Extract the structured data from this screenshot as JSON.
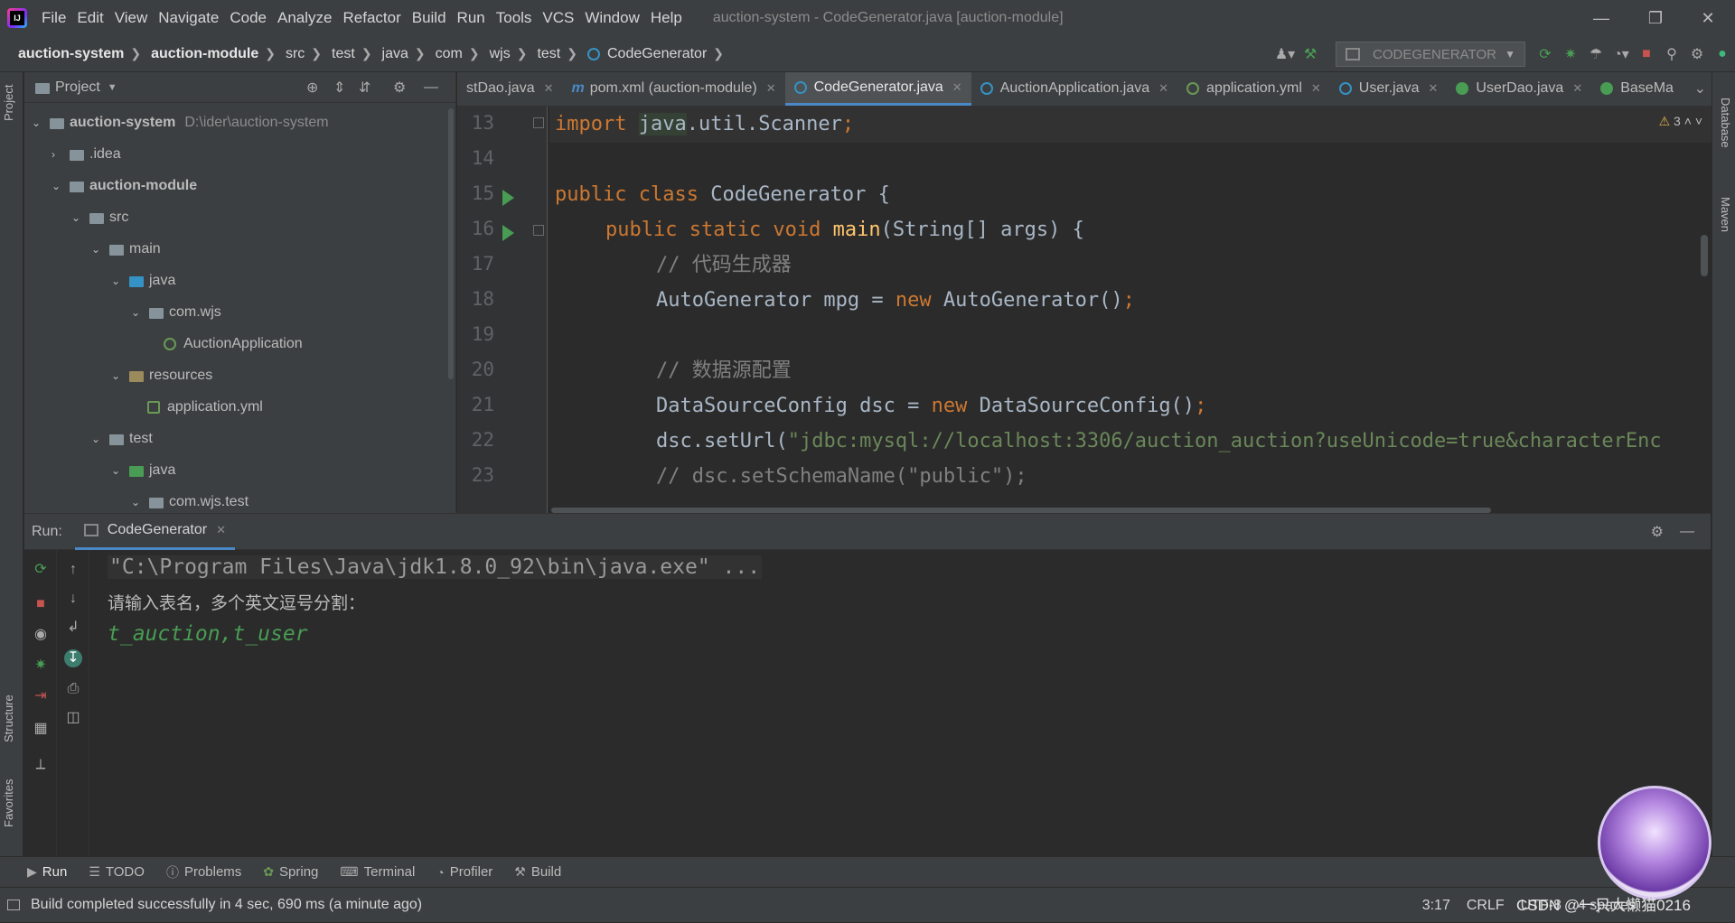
{
  "menu": {
    "items": [
      "File",
      "Edit",
      "View",
      "Navigate",
      "Code",
      "Analyze",
      "Refactor",
      "Build",
      "Run",
      "Tools",
      "VCS",
      "Window",
      "Help"
    ],
    "title": "auction-system - CodeGenerator.java [auction-module]"
  },
  "breadcrumb": [
    "auction-system",
    "auction-module",
    "src",
    "test",
    "java",
    "com",
    "wjs",
    "test",
    "CodeGenerator"
  ],
  "run_config": "CODEGENERATOR",
  "project": {
    "title": "Project",
    "tree": [
      {
        "label": "auction-system",
        "extra": "D:\\ider\\auction-system",
        "bold": true,
        "icon": "module-folder-icon"
      },
      {
        "label": ".idea",
        "icon": "folder-icon"
      },
      {
        "label": "auction-module",
        "bold": true,
        "icon": "module-folder-icon"
      },
      {
        "label": "src",
        "icon": "folder-icon"
      },
      {
        "label": "main",
        "icon": "folder-icon"
      },
      {
        "label": "java",
        "icon": "source-folder-icon"
      },
      {
        "label": "com.wjs",
        "icon": "package-icon"
      },
      {
        "label": "AuctionApplication",
        "icon": "spring-boot-class-icon"
      },
      {
        "label": "resources",
        "icon": "resources-folder-icon"
      },
      {
        "label": "application.yml",
        "icon": "yaml-file-icon"
      },
      {
        "label": "test",
        "icon": "folder-icon"
      },
      {
        "label": "java",
        "icon": "test-source-folder-icon"
      },
      {
        "label": "com.wjs.test",
        "icon": "package-icon"
      }
    ]
  },
  "tabs": [
    {
      "label": "stDao.java"
    },
    {
      "label": "pom.xml (auction-module)"
    },
    {
      "label": "CodeGenerator.java"
    },
    {
      "label": "AuctionApplication.java"
    },
    {
      "label": "application.yml"
    },
    {
      "label": "User.java"
    },
    {
      "label": "UserDao.java"
    },
    {
      "label": "BaseMa"
    }
  ],
  "editor": {
    "line_numbers": [
      "13",
      "14",
      "15",
      "16",
      "17",
      "18",
      "19",
      "20",
      "21",
      "22",
      "23"
    ],
    "warnings": "3",
    "lines": {
      "l13_kw": "import",
      "l13_a": "java",
      "l13_b": ".util.Scanner",
      "l13_c": ";",
      "l15_kw": "public class",
      "l15_b": " CodeGenerator {",
      "l16_kw": "public static void",
      "l16_fn": "main",
      "l16_b": "(String[] args) {",
      "l17_cm": "// 代码生成器",
      "l18_a": "AutoGenerator mpg = ",
      "l18_kw": "new",
      "l18_b": " AutoGenerator()",
      "l18_c": ";",
      "l20_cm": "// 数据源配置",
      "l21_a": "DataSourceConfig dsc = ",
      "l21_kw": "new",
      "l21_b": " DataSourceConfig()",
      "l21_c": ";",
      "l22_a": "dsc.setUrl(",
      "l22_st": "\"jdbc:mysql://localhost:3306/auction_auction?useUnicode=true&characterEnc",
      "l23_cm": "// dsc.setSchemaName(\"public\");"
    }
  },
  "run": {
    "label": "Run:",
    "tab": "CodeGenerator",
    "console": [
      "\"C:\\Program Files\\Java\\jdk1.8.0_92\\bin\\java.exe\" ...",
      "请输入表名，多个英文逗号分割：",
      "t_auction,t_user"
    ]
  },
  "bottom_tabs": [
    "Run",
    "TODO",
    "Problems",
    "Spring",
    "Terminal",
    "Profiler",
    "Build"
  ],
  "status": {
    "message": "Build completed successfully in 4 sec, 690 ms (a minute ago)",
    "position": "3:17",
    "line_sep": "CRLF",
    "encoding": "UTF-8",
    "indent": "4 spaces"
  },
  "side": {
    "left": [
      "Project",
      "Structure",
      "Favorites"
    ],
    "right": [
      "Database",
      "Maven"
    ]
  },
  "watermark": "CSDN @一只大懒猫0216",
  "colors": {
    "accent": "#4a88c7",
    "run_green": "#499c54",
    "keyword": "#cc7832",
    "string": "#6a8759",
    "comment": "#808080",
    "function": "#ffc66d"
  }
}
